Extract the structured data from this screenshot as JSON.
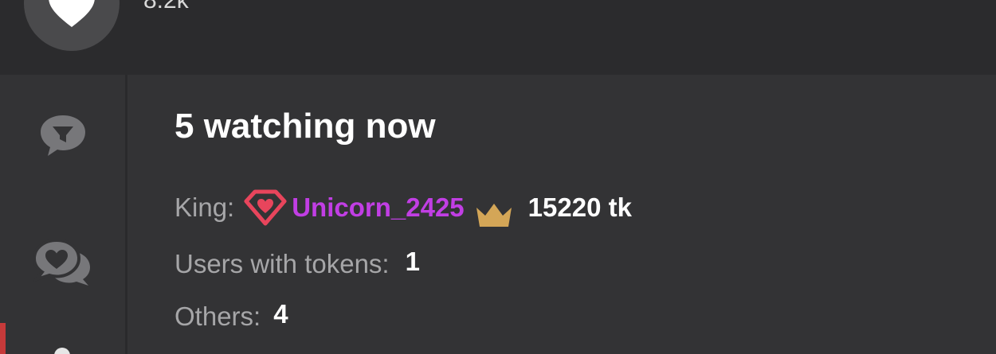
{
  "like": {
    "count": "8.2k",
    "icon": "heart-icon"
  },
  "sidebar": {
    "items": [
      {
        "name": "filter-chat",
        "icon": "speech-filter-icon"
      },
      {
        "name": "private-chat",
        "icon": "chat-heart-icon"
      },
      {
        "name": "users",
        "icon": "user-icon"
      }
    ]
  },
  "viewers": {
    "title": "5 watching now",
    "king": {
      "label": "King:",
      "username": "Unicorn_2425",
      "tokens": "15220 tk",
      "username_color": "#c13ee4",
      "gem_color": "#e8455c",
      "crown_color": "#d4a657"
    },
    "users_with_tokens": {
      "label": "Users with tokens:",
      "value": "1"
    },
    "others": {
      "label": "Others:",
      "value": "4"
    }
  },
  "colors": {
    "background": "#333335",
    "top_strip": "#2b2b2d",
    "active_tab": "#c63a3a"
  }
}
